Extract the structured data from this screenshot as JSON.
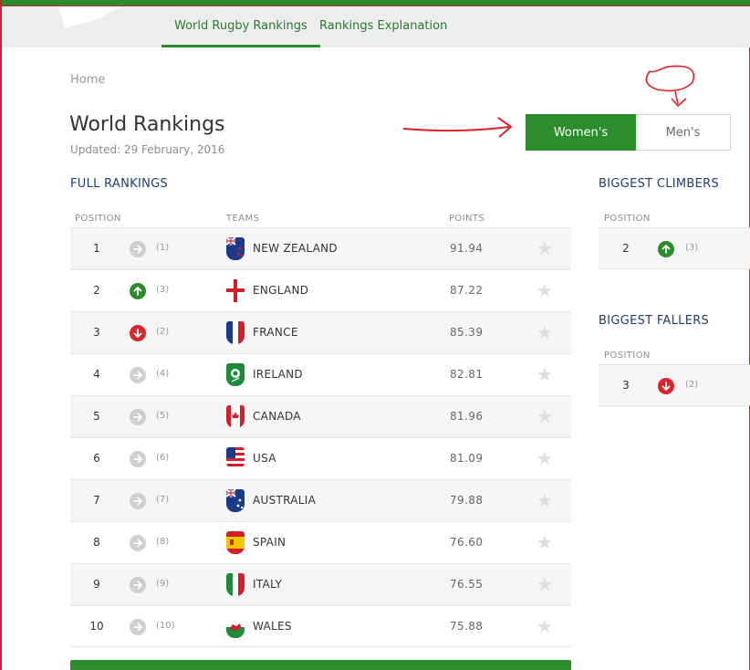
{
  "nav": {
    "items": [
      {
        "label": "World Rugby Rankings",
        "active": true
      },
      {
        "label": "Rankings Explanation",
        "active": false
      }
    ]
  },
  "breadcrumb": "Home",
  "page": {
    "title": "World Rankings",
    "updated": "Updated: 29 February, 2016"
  },
  "toggle": {
    "womens": "Women's",
    "mens": "Men's",
    "selected": "womens"
  },
  "full_rankings": {
    "title": "FULL RANKINGS",
    "headers": {
      "position": "POSITION",
      "teams": "TEAMS",
      "points": "POINTS"
    },
    "rows": [
      {
        "position": "1",
        "movement": "same",
        "previous": "(1)",
        "team": "NEW ZEALAND",
        "points": "91.94",
        "flag": "new-zealand"
      },
      {
        "position": "2",
        "movement": "up",
        "previous": "(3)",
        "team": "ENGLAND",
        "points": "87.22",
        "flag": "england"
      },
      {
        "position": "3",
        "movement": "down",
        "previous": "(2)",
        "team": "FRANCE",
        "points": "85.39",
        "flag": "france"
      },
      {
        "position": "4",
        "movement": "same",
        "previous": "(4)",
        "team": "IRELAND",
        "points": "82.81",
        "flag": "ireland"
      },
      {
        "position": "5",
        "movement": "same",
        "previous": "(5)",
        "team": "CANADA",
        "points": "81.96",
        "flag": "canada"
      },
      {
        "position": "6",
        "movement": "same",
        "previous": "(6)",
        "team": "USA",
        "points": "81.09",
        "flag": "usa"
      },
      {
        "position": "7",
        "movement": "same",
        "previous": "(7)",
        "team": "AUSTRALIA",
        "points": "79.88",
        "flag": "australia"
      },
      {
        "position": "8",
        "movement": "same",
        "previous": "(8)",
        "team": "SPAIN",
        "points": "76.60",
        "flag": "spain"
      },
      {
        "position": "9",
        "movement": "same",
        "previous": "(9)",
        "team": "ITALY",
        "points": "76.55",
        "flag": "italy"
      },
      {
        "position": "10",
        "movement": "same",
        "previous": "(10)",
        "team": "WALES",
        "points": "75.88",
        "flag": "wales"
      }
    ]
  },
  "biggest_climbers": {
    "title": "BIGGEST CLIMBERS",
    "header": "POSITION",
    "rows": [
      {
        "position": "2",
        "movement": "up",
        "previous": "(3)"
      }
    ]
  },
  "biggest_fallers": {
    "title": "BIGGEST FALLERS",
    "header": "POSITION",
    "rows": [
      {
        "position": "3",
        "movement": "down",
        "previous": "(2)"
      }
    ]
  },
  "colors": {
    "brand_green": "#2c8b2a",
    "down_red": "#d9262c",
    "neutral_grey": "#cfcfcf",
    "heading_blue": "#1e3f6f",
    "annotation_red": "#e0202a"
  }
}
